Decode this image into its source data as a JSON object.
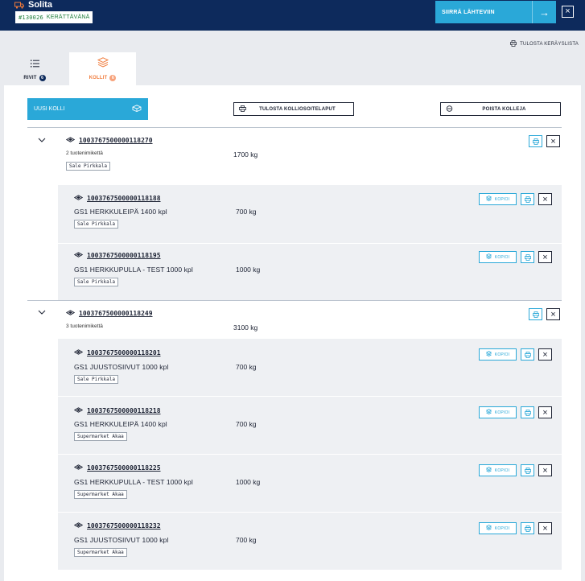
{
  "header": {
    "app_name": "Solita",
    "order_number": "#130026",
    "order_status": "KERÄTTÄVÄNÄ",
    "send_label": "SIIRRÄ LÄHTEVIIN",
    "close_symbol": "×"
  },
  "print_list_label": "TULOSTA KERÄYSLISTA",
  "tabs": [
    {
      "label": "RIVIT",
      "count": "6"
    },
    {
      "label": "KOLLIT",
      "count": "6"
    }
  ],
  "actions": {
    "new_package": "UUSI KOLLI",
    "print_labels": "TULOSTA KOLLIOSOITELAPUT",
    "remove_packages": "POISTA KOLLEJA",
    "copy_label": "KOPIOI",
    "close_symbol": "×"
  },
  "groups": [
    {
      "code": "1003767500000118270",
      "item_count": "2 tuotenimikettä",
      "tag": "Sale Pirkkala",
      "weight": "1700 kg",
      "children": [
        {
          "code": "1003767500000118188",
          "name": "GS1 HERKKULEIPÄ 1400 kpl",
          "weight": "700 kg",
          "tag": "Sale Pirkkala"
        },
        {
          "code": "1003767500000118195",
          "name": "GS1 HERKKUPULLA - TEST 1000 kpl",
          "weight": "1000 kg",
          "tag": "Sale Pirkkala"
        }
      ]
    },
    {
      "code": "1003767500000118249",
      "item_count": "3 tuotenimikettä",
      "weight": "3100 kg",
      "children": [
        {
          "code": "1003767500000118201",
          "name": "GS1 JUUSTOSIIVUT 1000 kpl",
          "weight": "700 kg",
          "tag": "Sale Pirkkala"
        },
        {
          "code": "1003767500000118218",
          "name": "GS1 HERKKULEIPÄ 1400 kpl",
          "weight": "700 kg",
          "tag": "Supermarket Akaa"
        },
        {
          "code": "1003767500000118225",
          "name": "GS1 HERKKUPULLA - TEST 1000 kpl",
          "weight": "1000 kg",
          "tag": "Supermarket Akaa"
        },
        {
          "code": "1003767500000118232",
          "name": "GS1 JUUSTOSIIVUT 1000 kpl",
          "weight": "700 kg",
          "tag": "Supermarket Akaa"
        }
      ]
    }
  ],
  "colors": {
    "header_bg": "#0d2a5c",
    "accent": "#2aa8d8",
    "tab_active": "#f07a3a",
    "status_green": "#1e7d3a"
  }
}
